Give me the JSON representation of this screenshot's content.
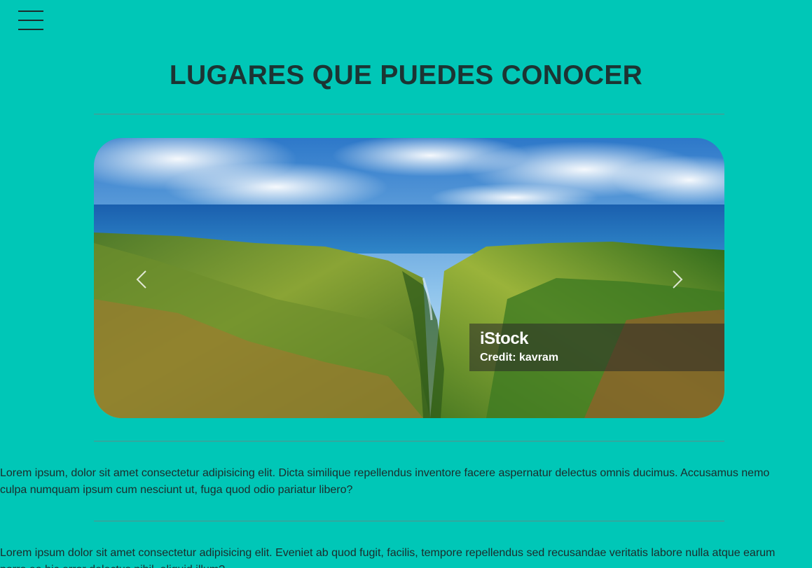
{
  "nav": {
    "menu_icon": "hamburger-menu-icon"
  },
  "header": {
    "title": "LUGARES QUE PUEDES CONOCER"
  },
  "carousel": {
    "prev_icon": "chevron-left-icon",
    "next_icon": "chevron-right-icon",
    "watermark_brand": "iStock",
    "watermark_credit": "Credit: kavram"
  },
  "content": {
    "paragraphs": [
      "Lorem ipsum, dolor sit amet consectetur adipisicing elit. Dicta similique repellendus inventore facere aspernatur delectus omnis ducimus. Accusamus nemo culpa numquam ipsum cum nesciunt ut, fuga quod odio pariatur libero?",
      "Lorem ipsum dolor sit amet consectetur adipisicing elit. Eveniet ab quod fugit, facilis, tempore repellendus sed recusandae veritatis labore nulla atque earum porro ea hic error delectus nihil, aliquid illum?"
    ]
  },
  "colors": {
    "background": "#00c7b7",
    "title": "#1c3433",
    "divider": "#3aa39b"
  }
}
